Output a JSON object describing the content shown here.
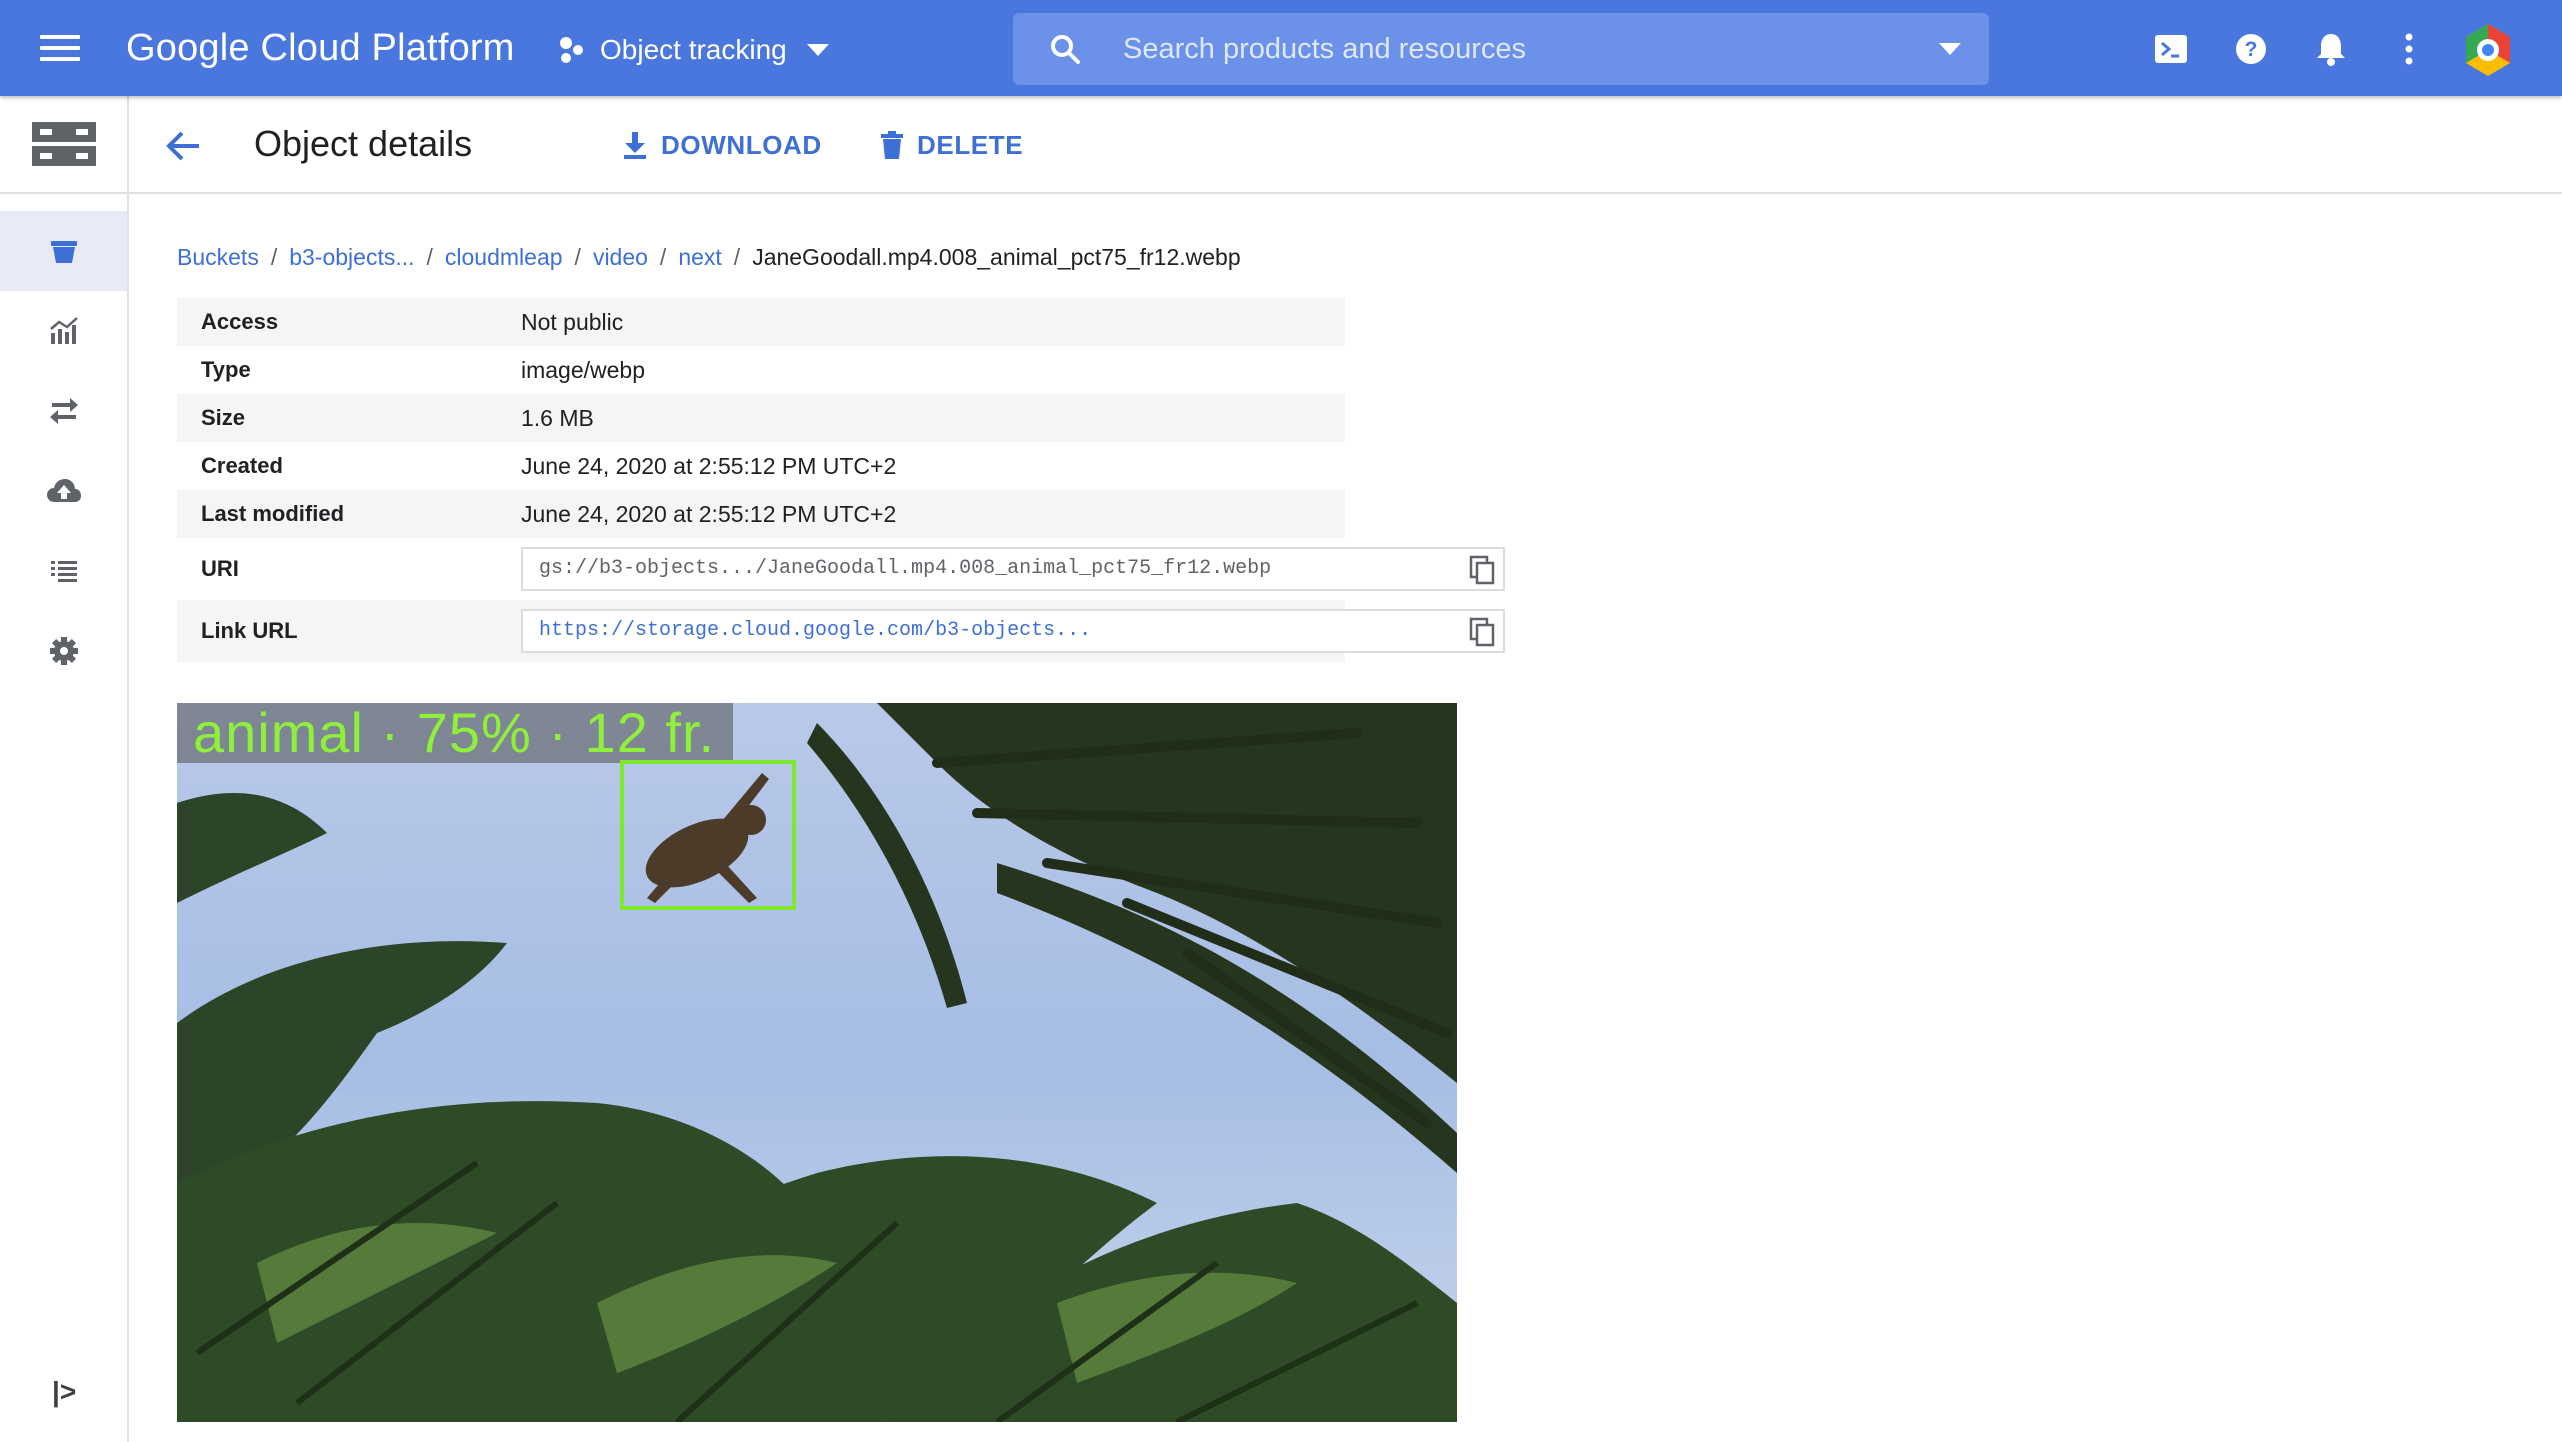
{
  "topbar": {
    "app_title": "Google Cloud Platform",
    "project_name": "Object tracking",
    "search_placeholder": "Search products and resources",
    "icons": [
      "menu-icon",
      "project-dots-icon",
      "search-icon",
      "terminal-icon",
      "help-icon",
      "notifications-icon",
      "more-vert-icon"
    ],
    "accent_color": "#4a77de"
  },
  "leftrail": {
    "items": [
      {
        "icon": "bucket-icon",
        "active": true
      },
      {
        "icon": "monitoring-icon",
        "active": false
      },
      {
        "icon": "transfer-icon",
        "active": false
      },
      {
        "icon": "cloud-upload-icon",
        "active": false
      },
      {
        "icon": "list-icon",
        "active": false
      },
      {
        "icon": "settings-icon",
        "active": false
      }
    ],
    "expand_label": "|>"
  },
  "actionbar": {
    "title": "Object details",
    "download_label": "DOWNLOAD",
    "delete_label": "DELETE"
  },
  "breadcrumb": {
    "links": [
      "Buckets",
      "b3-objects...",
      "cloudmleap",
      "video",
      "next"
    ],
    "separator": "/",
    "current": "JaneGoodall.mp4.008_animal_pct75_fr12.webp"
  },
  "details": {
    "access": {
      "label": "Access",
      "value": "Not public"
    },
    "type": {
      "label": "Type",
      "value": "image/webp"
    },
    "size": {
      "label": "Size",
      "value": "1.6 MB"
    },
    "created": {
      "label": "Created",
      "value": "June 24, 2020 at 2:55:12 PM UTC+2"
    },
    "last_modified": {
      "label": "Last modified",
      "value": "June 24, 2020 at 2:55:12 PM UTC+2"
    },
    "uri": {
      "label": "URI",
      "value": "gs://b3-objects.../JaneGoodall.mp4.008_animal_pct75_fr12.webp"
    },
    "link_url": {
      "label": "Link URL",
      "value": "https://storage.cloud.google.com/b3-objects..."
    }
  },
  "preview": {
    "overlay_text": "animal · 75% · 12 fr.",
    "detection_color": "#7ee82e"
  }
}
